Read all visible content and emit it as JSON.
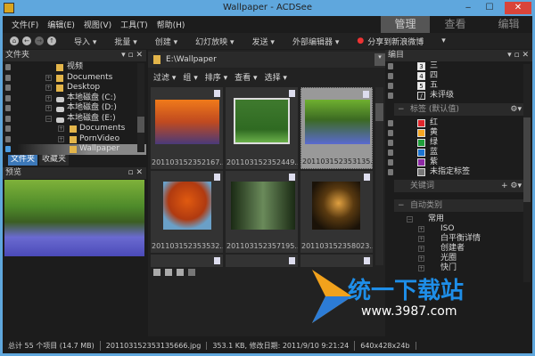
{
  "window": {
    "title": "Wallpaper - ACDSee",
    "min": "‒",
    "max": "☐",
    "close": "✕"
  },
  "menu": [
    "文件(F)",
    "编辑(E)",
    "视图(V)",
    "工具(T)",
    "帮助(H)"
  ],
  "modes": {
    "manage": "管理",
    "view": "查看",
    "edit": "编辑"
  },
  "toolbar": {
    "nav": [
      "⌂",
      "←",
      "→",
      "↑"
    ],
    "items": [
      "导入 ▾",
      "批量 ▾",
      "创建 ▾",
      "幻灯放映 ▾",
      "发送 ▾",
      "外部编辑器 ▾",
      "分享到新浪微博",
      "▾"
    ]
  },
  "folders": {
    "title": "文件夹",
    "tree": [
      "视频",
      "Documents",
      "Desktop",
      "本地磁盘 (C:)",
      "本地磁盘 (D:)",
      "本地磁盘 (E:)",
      "Documents",
      "PornVideo",
      "Wallpaper"
    ],
    "tabs": [
      "文件夹",
      "收藏夹"
    ]
  },
  "preview": {
    "title": "预览"
  },
  "browser": {
    "path": "E:\\Wallpaper",
    "filters": [
      "过滤 ▾",
      "组 ▾",
      "排序 ▾",
      "查看 ▾",
      "选择 ▾"
    ],
    "thumbs": [
      "201103152352167...",
      "201103152352449...",
      "201103152353135...",
      "201103152353532...",
      "201103152357195...",
      "201103152358023..."
    ]
  },
  "catalog": {
    "title": "编目",
    "ratings": [
      {
        "n": "3",
        "label": "三"
      },
      {
        "n": "4",
        "label": "四"
      },
      {
        "n": "5",
        "label": "五"
      },
      {
        "n": "/",
        "label": "未评级"
      }
    ],
    "labels_title": "标签 (默认值)",
    "labels": [
      {
        "label": "红",
        "color": "#e0262c"
      },
      {
        "label": "黄",
        "color": "#f5a623"
      },
      {
        "label": "绿",
        "color": "#1f9e3a"
      },
      {
        "label": "蓝",
        "color": "#1c74d1"
      },
      {
        "label": "紫",
        "color": "#8e2aa6"
      },
      {
        "label": "未指定标签",
        "color": "#777777"
      }
    ],
    "keywords": "关键词",
    "auto": "自动类别",
    "auto_tree": [
      "常用",
      "ISO",
      "白平衡详情",
      "创建者",
      "光圈",
      "快门"
    ]
  },
  "status": [
    "总计 55 个项目 (14.7 MB)",
    "201103152353135666.jpg",
    "353.1 KB, 修改日期: 2011/9/10 9:21:24",
    "640x428x24b"
  ],
  "watermark": {
    "name": "统一下载站",
    "url": "www.3987.com"
  }
}
